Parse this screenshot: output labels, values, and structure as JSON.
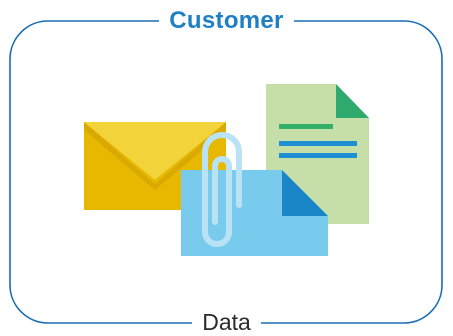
{
  "title": "Customer",
  "footer": "Data",
  "colors": {
    "title": "#1f7fc4",
    "frame": "#1a6db3",
    "footer": "#2b2b2b",
    "envelope_body": "#e6b800",
    "envelope_flap": "#f2d43a",
    "envelope_fold": "#d9a900",
    "doc_green": "#c6dfa9",
    "doc_green_fold": "#2eaa6e",
    "doc_green_line1": "#35b06b",
    "doc_green_lines": "#1f8fd4",
    "doc_blue": "#79cbee",
    "doc_blue_fold": "#1a86c8",
    "clip": "#b9e2f4"
  },
  "icons": [
    "envelope-icon",
    "green-document-icon",
    "blue-document-icon",
    "paperclip-icon"
  ]
}
